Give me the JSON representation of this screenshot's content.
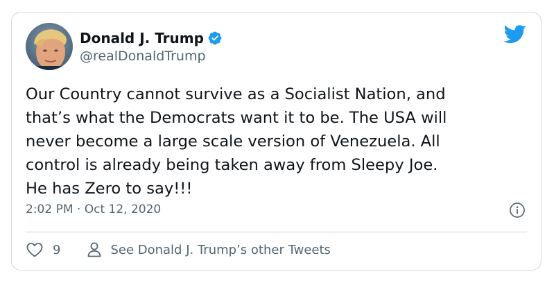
{
  "tweet": {
    "author": {
      "display_name": "Donald J. Trump",
      "handle": "@realDonaldTrump",
      "verified": true
    },
    "text": "Our Country cannot survive as a Socialist Nation, and\nthat’s what the Democrats want it to be. The USA will\nnever become a large scale version of Venezuela. All\ncontrol is already being taken away from Sleepy Joe.\nHe has Zero to say!!!",
    "time": "2:02 PM",
    "separator": "·",
    "date": "Oct 12, 2020",
    "like_count": "9",
    "profile_link_label": "See Donald J. Trump’s other Tweets"
  },
  "icons": {
    "brand": "twitter-bird-icon",
    "verified": "verified-badge-icon",
    "info": "info-icon",
    "like": "heart-icon",
    "profile": "person-icon"
  },
  "colors": {
    "brand_blue": "#1d9bf0",
    "text_primary": "#0f1419",
    "text_secondary": "#536471",
    "border": "#cfd9de"
  }
}
